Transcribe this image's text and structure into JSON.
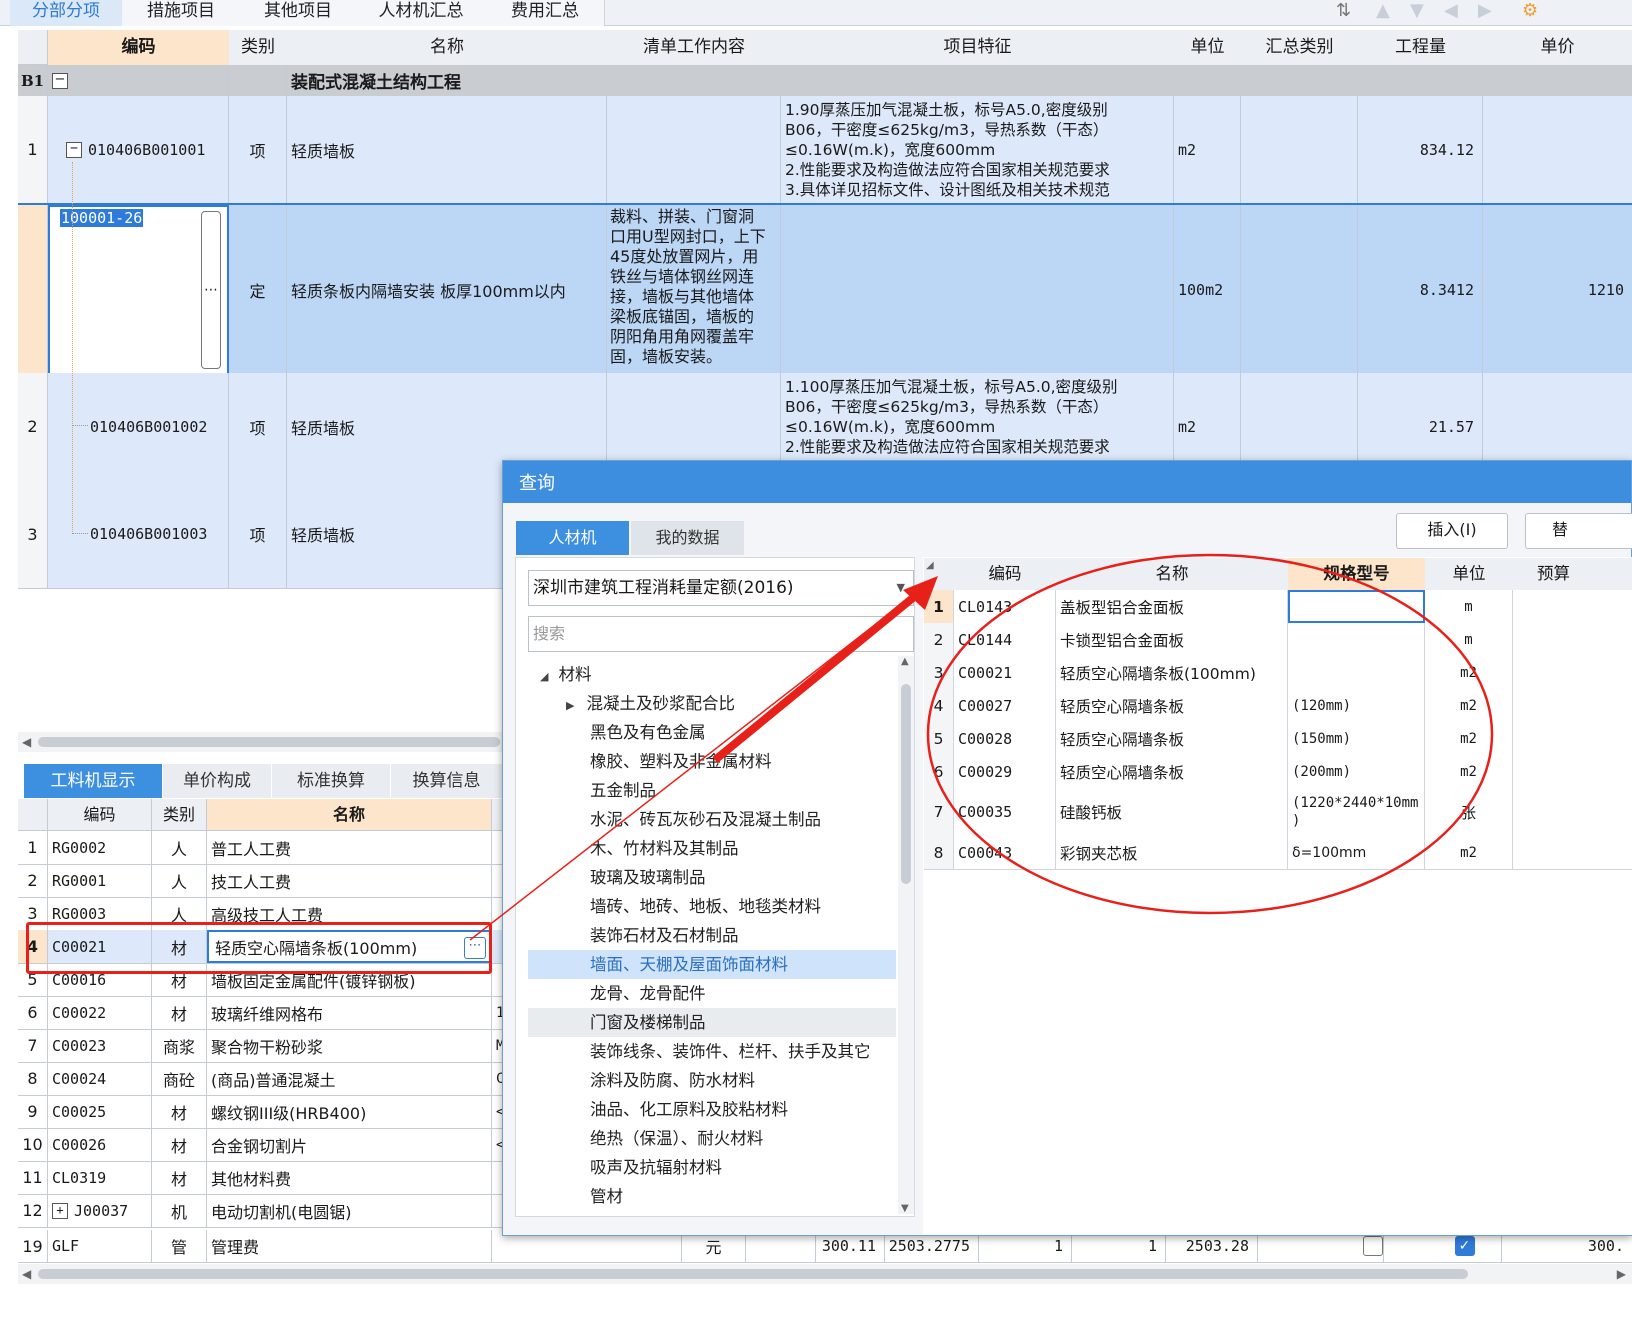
{
  "top_tabs": [
    "分部分项",
    "措施项目",
    "其他项目",
    "人材机汇总",
    "费用汇总"
  ],
  "grid": {
    "headers": [
      "编码",
      "类别",
      "名称",
      "清单工作内容",
      "项目特征",
      "单位",
      "汇总类别",
      "工程量",
      "单价"
    ],
    "b1": {
      "label": "B1",
      "name": "装配式混凝土结构工程"
    },
    "rows": [
      {
        "num": "1",
        "code": "010406B001001",
        "type": "项",
        "name": "轻质墙板",
        "work": "",
        "feature": "1.90厚蒸压加气混凝土板，标号A5.0,密度级别\nB06，干密度≤625kg/m3，导热系数（干态）\n≤0.16W(m.k)，宽度600mm\n2.性能要求及构造做法应符合国家相关规范要求\n3.具体详见招标文件、设计图纸及相关技术规范",
        "unit": "m2",
        "qty": "834.12",
        "price": ""
      },
      {
        "num": "",
        "code": "100001-26",
        "type": "定",
        "name": "轻质条板内隔墙安装 板厚100mm以内",
        "work": "裁料、拼装、门窗洞\n口用U型网封口，上下\n45度处放置网片，用\n铁丝与墙体钢丝网连\n接，墙板与其他墙体\n梁板底锚固，墙板的\n阴阳角用角网覆盖牢\n固，墙板安装。",
        "feature": "",
        "unit": "100m2",
        "qty": "8.3412",
        "price": "1210"
      },
      {
        "num": "2",
        "code": "010406B001002",
        "type": "项",
        "name": "轻质墙板",
        "work": "",
        "feature": "1.100厚蒸压加气混凝土板，标号A5.0,密度级别\nB06，干密度≤625kg/m3，导热系数（干态）\n≤0.16W(m.k)，宽度600mm\n2.性能要求及构造做法应符合国家相关规范要求",
        "unit": "m2",
        "qty": "21.57",
        "price": ""
      },
      {
        "num": "3",
        "code": "010406B001003",
        "type": "项",
        "name": "轻质墙板",
        "work": "",
        "feature": "",
        "unit": "",
        "qty": "",
        "price": ""
      }
    ]
  },
  "lower": {
    "tabs": [
      "工料机显示",
      "单价构成",
      "标准换算",
      "换算信息"
    ],
    "headers": [
      "编码",
      "类别",
      "名称"
    ],
    "rows": [
      {
        "num": "1",
        "code": "RG0002",
        "type": "人",
        "name": "普工人工费",
        "extra": ""
      },
      {
        "num": "2",
        "code": "RG0001",
        "type": "人",
        "name": "技工人工费",
        "extra": ""
      },
      {
        "num": "3",
        "code": "RG0003",
        "type": "人",
        "name": "高级技工人工费",
        "extra": ""
      },
      {
        "num": "4",
        "code": "C00021",
        "type": "材",
        "name": "轻质空心隔墙条板(100mm)",
        "extra": ""
      },
      {
        "num": "5",
        "code": "C00016",
        "type": "材",
        "name": "墙板固定金属配件(镀锌钢板)",
        "extra": ""
      },
      {
        "num": "6",
        "code": "C00022",
        "type": "材",
        "name": "玻璃纤维网格布",
        "extra": "1"
      },
      {
        "num": "7",
        "code": "C00023",
        "type": "商浆",
        "name": "聚合物干粉砂浆",
        "extra": "M"
      },
      {
        "num": "8",
        "code": "C00024",
        "type": "商砼",
        "name": "(商品)普通混凝土",
        "extra": "C"
      },
      {
        "num": "9",
        "code": "C00025",
        "type": "材",
        "name": "螺纹钢III级(HRB400)",
        "extra": "<"
      },
      {
        "num": "10",
        "code": "C00026",
        "type": "材",
        "name": "合金钢切割片",
        "extra": "<"
      },
      {
        "num": "11",
        "code": "CL0319",
        "type": "材",
        "name": "其他材料费",
        "extra": ""
      },
      {
        "num": "12",
        "code": "J00037",
        "type": "机",
        "name": "电动切割机(电圆锯)",
        "extra": ""
      }
    ],
    "last": {
      "num": "19",
      "code": "GLF",
      "type": "管",
      "name": "管理费",
      "unit": "元",
      "v1": "300.11",
      "v2": "2503.2775",
      "v3": "1",
      "v4": "1",
      "v5": "2503.28",
      "v6": "300."
    }
  },
  "dialog": {
    "title": "查询",
    "tabs": [
      "人材机",
      "我的数据"
    ],
    "buttons": [
      "插入(I)",
      "替"
    ],
    "quota": "深圳市建筑工程消耗量定额(2016)",
    "search_placeholder": "搜索",
    "tree_root": "材料",
    "tree": [
      "混凝土及砂浆配合比",
      "黑色及有色金属",
      "橡胶、塑料及非金属材料",
      "五金制品",
      "水泥、砖瓦灰砂石及混凝土制品",
      "木、竹材料及其制品",
      "玻璃及玻璃制品",
      "墙砖、地砖、地板、地毯类材料",
      "装饰石材及石材制品",
      "墙面、天棚及屋面饰面材料",
      "龙骨、龙骨配件",
      "门窗及楼梯制品",
      "装饰线条、装饰件、栏杆、扶手及其它",
      "涂料及防腐、防水材料",
      "油品、化工原料及胶粘材料",
      "绝热（保温）、耐火材料",
      "吸声及抗辐射材料",
      "管材"
    ],
    "headers": [
      "编码",
      "名称",
      "规格型号",
      "单位",
      "预算"
    ],
    "rows": [
      {
        "num": "1",
        "code": "CL0143",
        "name": "盖板型铝合金面板",
        "spec": "",
        "unit": "m"
      },
      {
        "num": "2",
        "code": "CL0144",
        "name": "卡锁型铝合金面板",
        "spec": "",
        "unit": "m"
      },
      {
        "num": "3",
        "code": "C00021",
        "name": "轻质空心隔墙条板(100mm)",
        "spec": "",
        "unit": "m2"
      },
      {
        "num": "4",
        "code": "C00027",
        "name": "轻质空心隔墙条板",
        "spec": "(120mm)",
        "unit": "m2"
      },
      {
        "num": "5",
        "code": "C00028",
        "name": "轻质空心隔墙条板",
        "spec": "(150mm)",
        "unit": "m2"
      },
      {
        "num": "6",
        "code": "C00029",
        "name": "轻质空心隔墙条板",
        "spec": "(200mm)",
        "unit": "m2"
      },
      {
        "num": "7",
        "code": "C00035",
        "name": "硅酸钙板",
        "spec": "(1220*2440*10mm\n)",
        "unit": "张"
      },
      {
        "num": "8",
        "code": "C00043",
        "name": "彩钢夹芯板",
        "spec": "δ=100mm",
        "unit": "m2"
      }
    ]
  },
  "colors": {
    "accent": "#3e8ee0",
    "row_blue": "#dde9fa",
    "header_active": "#fde5cc",
    "annotation_red": "#e8201a"
  }
}
